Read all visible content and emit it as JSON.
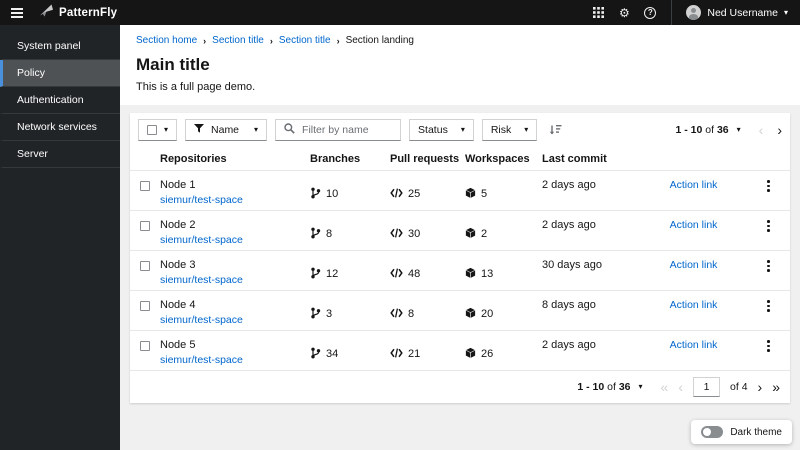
{
  "masthead": {
    "brand": "PatternFly",
    "user_name": "Ned Username"
  },
  "sidebar": {
    "items": [
      {
        "label": "System panel"
      },
      {
        "label": "Policy"
      },
      {
        "label": "Authentication"
      },
      {
        "label": "Network services"
      },
      {
        "label": "Server"
      }
    ]
  },
  "breadcrumb": {
    "items": [
      {
        "label": "Section home"
      },
      {
        "label": "Section title"
      },
      {
        "label": "Section title"
      },
      {
        "label": "Section landing"
      }
    ]
  },
  "page": {
    "title": "Main title",
    "description": "This is a full page demo."
  },
  "toolbar": {
    "name_filter_label": "Name",
    "search_placeholder": "Filter by name",
    "status_label": "Status",
    "risk_label": "Risk"
  },
  "pagination_top": {
    "range": "1 - 10",
    "of": "of",
    "total": "36"
  },
  "pagination_bottom": {
    "range": "1 - 10",
    "of": "of",
    "total": "36",
    "current_page": "1",
    "of_pages": "of 4"
  },
  "table": {
    "columns": [
      "Repositories",
      "Branches",
      "Pull requests",
      "Workspaces",
      "Last commit"
    ],
    "action_label": "Action link",
    "rows": [
      {
        "name": "Node 1",
        "link": "siemur/test-space",
        "branches": "10",
        "pull_requests": "25",
        "workspaces": "5",
        "last_commit": "2 days ago"
      },
      {
        "name": "Node 2",
        "link": "siemur/test-space",
        "branches": "8",
        "pull_requests": "30",
        "workspaces": "2",
        "last_commit": "2 days ago"
      },
      {
        "name": "Node 3",
        "link": "siemur/test-space",
        "branches": "12",
        "pull_requests": "48",
        "workspaces": "13",
        "last_commit": "30 days ago"
      },
      {
        "name": "Node 4",
        "link": "siemur/test-space",
        "branches": "3",
        "pull_requests": "8",
        "workspaces": "20",
        "last_commit": "8 days ago"
      },
      {
        "name": "Node 5",
        "link": "siemur/test-space",
        "branches": "34",
        "pull_requests": "21",
        "workspaces": "26",
        "last_commit": "2 days ago"
      }
    ]
  },
  "theme_toggle": {
    "label": "Dark theme"
  },
  "colors": {
    "accent": "#0066cc",
    "masthead_bg": "#151515",
    "sidebar_bg": "#212427",
    "nav_active_border": "#4a90dd"
  }
}
